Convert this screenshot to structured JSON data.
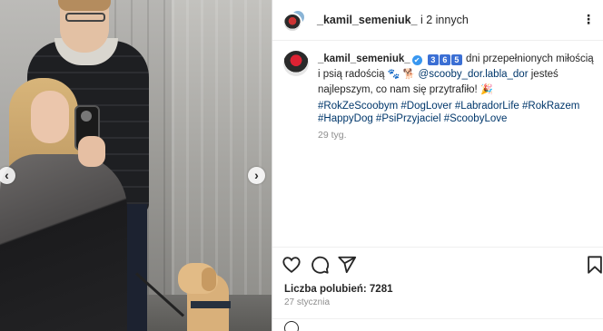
{
  "header": {
    "username": "_kamil_semeniuk_",
    "collab_text": " i 2 innych",
    "more_label": "⋮"
  },
  "photo": {
    "prev_label": "‹",
    "next_label": "›"
  },
  "caption": {
    "username": "_kamil_semeniuk_",
    "verified_mark": "✔",
    "keycaps": [
      "3",
      "6",
      "5"
    ],
    "text_part1": " dni przepełnionych miłością i psią radością ",
    "emoji_paws": "🐾",
    "emoji_box": "🐕",
    "mention": "@scooby_dor.labla_dor",
    "text_part2": " jesteś najlepszym, co nam się przytrafiło! ",
    "emoji_party": "🎉",
    "hashtags_line1": "#RokZeScoobym #DogLover #LabradorLife #RokRazem",
    "hashtags_line2": "#HappyDog #PsiPrzyjaciel #ScoobyLove",
    "time_ago": "29 tyg."
  },
  "stats": {
    "likes": "Liczba polubień: 7281",
    "date": "27 stycznia"
  },
  "icons": {
    "like": "heart-icon",
    "comment": "comment-icon",
    "share": "share-icon",
    "save": "bookmark-icon"
  }
}
